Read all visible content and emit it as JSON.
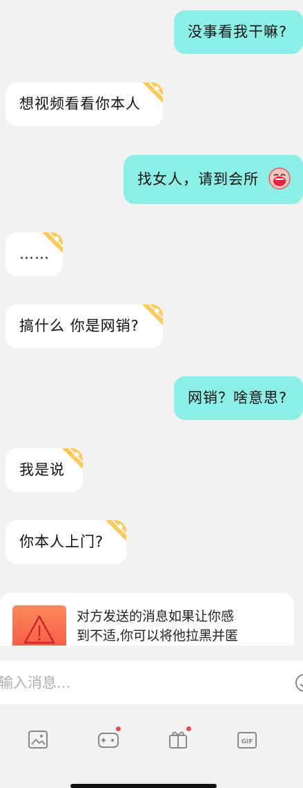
{
  "messages": [
    {
      "side": "out",
      "text": "没事看我干嘛?"
    },
    {
      "side": "in",
      "text": "想视频看看你本人"
    },
    {
      "side": "out",
      "text": "找女人，请到会所",
      "emoji": "laughing-crying-emoji"
    },
    {
      "side": "in",
      "text": "……"
    },
    {
      "side": "in",
      "text": "搞什么 你是网销?"
    },
    {
      "side": "out",
      "text": "网销？啥意思?"
    },
    {
      "side": "in",
      "text": "我是说"
    },
    {
      "side": "in",
      "text": "你本人上门?"
    }
  ],
  "warning": {
    "line1": "对方发送的消息如果让你感",
    "line2": "到不适,你可以将他拉黑并匿",
    "icon": "warning-triangle-icon"
  },
  "input": {
    "placeholder": "输入消息...",
    "value": ""
  },
  "toolbar": {
    "icons": [
      "image-icon",
      "game-controller-icon",
      "gift-icon",
      "gif-icon"
    ]
  },
  "colors": {
    "outgoing_bubble": "#8cefe7",
    "incoming_bubble": "#ffffff",
    "background": "#f2f2f2",
    "badge": "#ffc857",
    "notification_dot": "#f04848",
    "warning_gradient_top": "#ff8a5c",
    "warning_gradient_bottom": "#f2503f"
  }
}
